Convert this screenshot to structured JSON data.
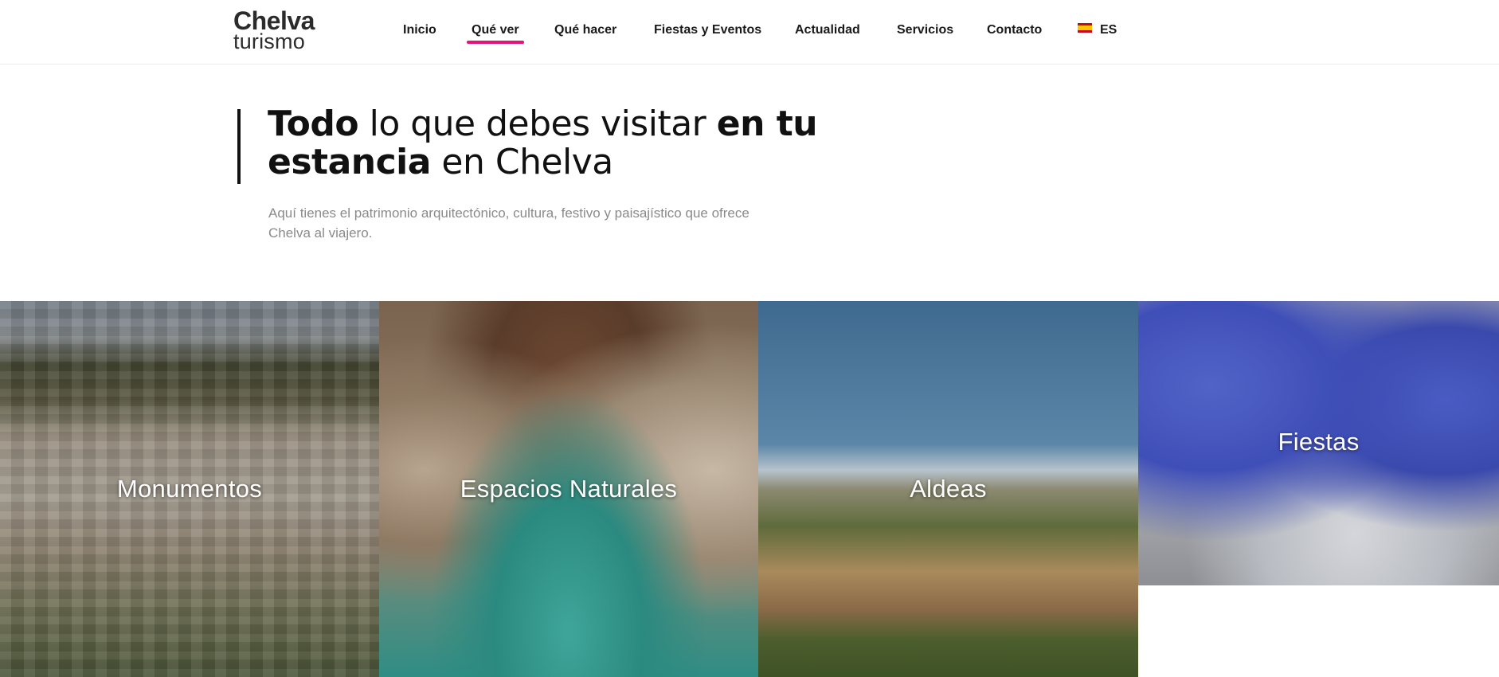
{
  "brand": {
    "line1": "Chelva",
    "line2": "turismo"
  },
  "nav": {
    "items": [
      {
        "label": "Inicio"
      },
      {
        "label": "Qué ver"
      },
      {
        "label": "Qué hacer"
      },
      {
        "label": "Fiestas y Eventos"
      },
      {
        "label": "Actualidad"
      },
      {
        "label": "Servicios"
      },
      {
        "label": "Contacto"
      }
    ],
    "active": "Qué ver",
    "language": "ES",
    "accent_color": "#e2147c"
  },
  "hero": {
    "title_parts": {
      "p1": "Todo",
      "p2": " lo que debes visitar ",
      "p3": "en tu estancia",
      "p4": " en Chelva"
    },
    "subtitle": "Aquí tienes el patrimonio arquitectónico, cultura, festivo y paisajístico que ofrece Chelva al viajero."
  },
  "tiles": [
    {
      "label": "Monumentos"
    },
    {
      "label": "Espacios Naturales"
    },
    {
      "label": "Aldeas"
    },
    {
      "label": "Fiestas"
    }
  ]
}
